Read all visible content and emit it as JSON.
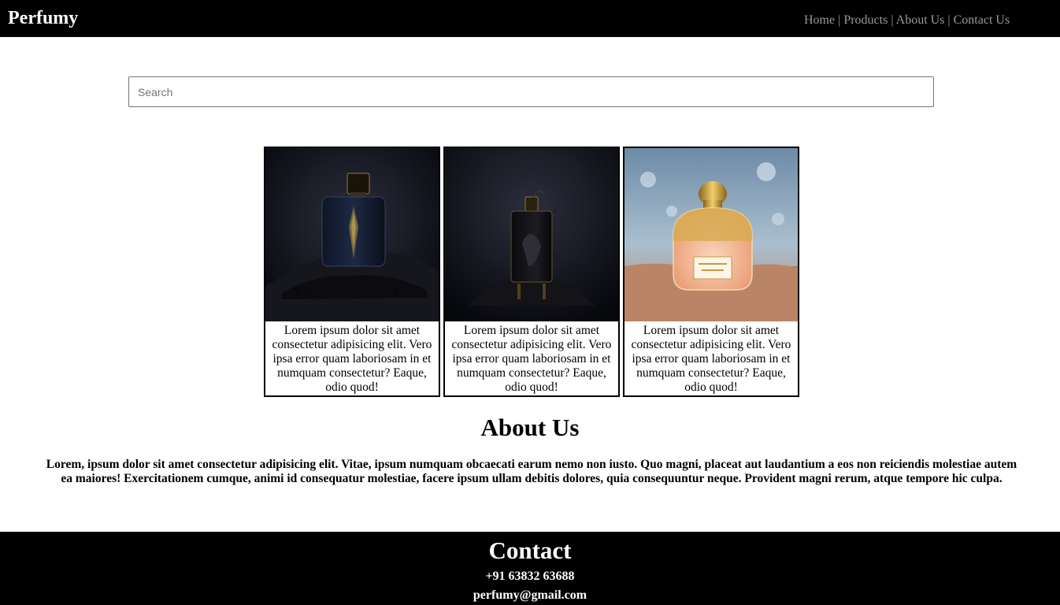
{
  "header": {
    "brand": "Perfumy",
    "nav": [
      {
        "label": "Home"
      },
      {
        "label": "Products"
      },
      {
        "label": "About Us"
      },
      {
        "label": "Contact Us"
      }
    ],
    "separator": "|"
  },
  "search": {
    "placeholder": "Search",
    "value": ""
  },
  "products": [
    {
      "description": "Lorem ipsum dolor sit amet consectetur adipisicing elit. Vero ipsa error quam laboriosam in et numquam consectetur? Eaque, odio quod!",
      "image": "dark-perfume-bottle-image"
    },
    {
      "description": "Lorem ipsum dolor sit amet consectetur adipisicing elit. Vero ipsa error quam laboriosam in et numquam consectetur? Eaque, odio quod!",
      "image": "black-perfume-bottle-splash-image"
    },
    {
      "description": "Lorem ipsum dolor sit amet consectetur adipisicing elit. Vero ipsa error quam laboriosam in et numquam consectetur? Eaque, odio quod!",
      "image": "gold-honeycomb-perfume-bottle-image"
    }
  ],
  "about": {
    "title": "About Us",
    "text": "Lorem, ipsum dolor sit amet consectetur adipisicing elit. Vitae, ipsum numquam obcaecati earum nemo non iusto. Quo magni, placeat aut laudantium a eos non reiciendis molestiae autem ea maiores! Exercitationem cumque, animi id consequatur molestiae, facere ipsum ullam debitis dolores, quia consequuntur neque. Provident magni rerum, atque tempore hic culpa."
  },
  "contact": {
    "title": "Contact",
    "phone": "+91 63832 63688",
    "email": "perfumy@gmail.com"
  },
  "colors": {
    "header_bg": "#000000",
    "nav_text": "#9a9a9a",
    "footer_bg": "#000000"
  }
}
